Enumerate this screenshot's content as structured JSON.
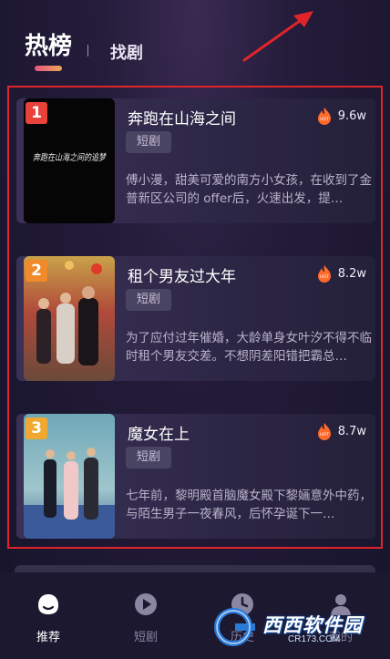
{
  "header": {
    "tab_hot": "热榜",
    "tab_find": "找剧"
  },
  "items": [
    {
      "rank": "1",
      "rank_color": "#e8423a",
      "title": "奔跑在山海之间",
      "tag": "短剧",
      "heat": "9.6w",
      "description": "傅小漫，甜美可爱的南方小女孩，在收到了金普新区公司的 offer后，火速出发，提…",
      "poster_text": "奔跑在山海之间的追梦"
    },
    {
      "rank": "2",
      "rank_color": "#f08a2a",
      "title": "租个男友过大年",
      "tag": "短剧",
      "heat": "8.2w",
      "description": "为了应付过年催婚，大龄单身女叶汐不得不临时租个男友交差。不想阴差阳错把霸总…"
    },
    {
      "rank": "3",
      "rank_color": "#f0a830",
      "title": "魔女在上",
      "tag": "短剧",
      "heat": "8.7w",
      "description": "七年前，黎明殿首脑魔女殿下黎婳意外中药，与陌生男子一夜春风，后怀孕诞下一…"
    }
  ],
  "nav": {
    "home": "推荐",
    "drama": "短剧",
    "history": "历史",
    "me": "我的"
  },
  "heat_badge": "HOT",
  "watermark": {
    "brand": "西西软件园",
    "url": "CR173.COM"
  },
  "colors": {
    "highlight_border": "#e0242a",
    "accent": "#ff6a2a"
  }
}
